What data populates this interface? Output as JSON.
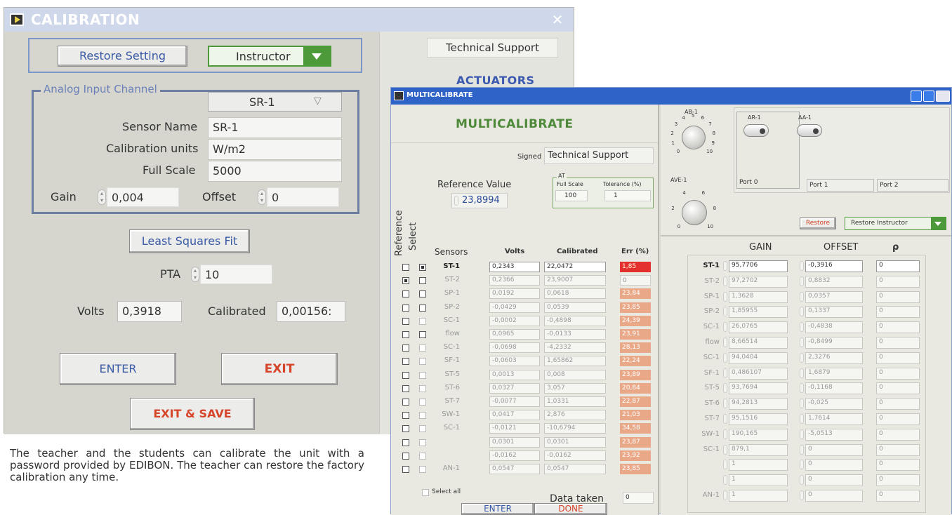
{
  "calibration": {
    "title": "CALIBRATION",
    "close_label": "✕",
    "restore_setting": "Restore Setting",
    "role": "Instructor",
    "group_label": "Analog Input Channel",
    "channel": "SR-1",
    "sensor_name_label": "Sensor Name",
    "sensor_name": "SR-1",
    "units_label": "Calibration units",
    "units": "W/m2",
    "full_scale_label": "Full Scale",
    "full_scale": "5000",
    "gain_label": "Gain",
    "gain": "0,004",
    "offset_label": "Offset",
    "offset": "0",
    "lsq_fit": "Least Squares Fit",
    "pta_label": "PTA",
    "pta": "10",
    "volts_label": "Volts",
    "volts": "0,3918",
    "calibrated_label": "Calibrated",
    "calibrated": "0,00156:",
    "enter": "ENTER",
    "exit": "EXIT",
    "exit_save": "EXIT & SAVE",
    "tech_support": "Technical Support",
    "actuators": "ACTUATORS"
  },
  "caption": "The teacher and the students can calibrate the unit with a password provided by EDIBON. The teacher can restore the factory calibration any time.",
  "multicalibrate": {
    "title": "MULTICALIBRATE",
    "heading": "MULTICALIBRATE",
    "signed_label": "Signed",
    "signed": "Technical Support",
    "ref_value_label": "Reference Value",
    "ref_value": "23,8994",
    "at_label": "AT",
    "full_scale_label": "Full Scale",
    "full_scale": "100",
    "tolerance_label": "Tolerance (%)",
    "tolerance": "1",
    "reference_label": "Reference",
    "select_label": "Select",
    "col_sensors": "Sensors",
    "col_volts": "Volts",
    "col_calibrated": "Calibrated",
    "col_err": "Err (%)",
    "select_all": "Select all",
    "data_taken_label": "Data taken",
    "data_taken": "0",
    "enter": "ENTER",
    "done": "DONE",
    "rows": [
      {
        "sensor": "ST-1",
        "volts": "0,2343",
        "calibrated": "22,0472",
        "err": "1,85"
      },
      {
        "sensor": "ST-2",
        "volts": "0,2366",
        "calibrated": "23,9007",
        "err": "0"
      },
      {
        "sensor": "SP-1",
        "volts": "0,0192",
        "calibrated": "0,0618",
        "err": "23,84"
      },
      {
        "sensor": "SP-2",
        "volts": "-0,0429",
        "calibrated": "0,0539",
        "err": "23,85"
      },
      {
        "sensor": "SC-1",
        "volts": "-0,0002",
        "calibrated": "-0,4898",
        "err": "24,39"
      },
      {
        "sensor": "flow",
        "volts": "0,0965",
        "calibrated": "-0,0133",
        "err": "23,91"
      },
      {
        "sensor": "SC-1",
        "volts": "-0,0698",
        "calibrated": "-4,2332",
        "err": "28,13"
      },
      {
        "sensor": "SF-1",
        "volts": "-0,0603",
        "calibrated": "1,65862",
        "err": "22,24"
      },
      {
        "sensor": "ST-5",
        "volts": "0,0013",
        "calibrated": "0,008",
        "err": "23,89"
      },
      {
        "sensor": "ST-6",
        "volts": "0,0327",
        "calibrated": "3,057",
        "err": "20,84"
      },
      {
        "sensor": "ST-7",
        "volts": "-0,0077",
        "calibrated": "1,0331",
        "err": "22,87"
      },
      {
        "sensor": "SW-1",
        "volts": "0,0417",
        "calibrated": "2,876",
        "err": "21,03"
      },
      {
        "sensor": "SC-1",
        "volts": "-0,0121",
        "calibrated": "-10,6794",
        "err": "34,58"
      },
      {
        "sensor": "",
        "volts": "0,0301",
        "calibrated": "0,0301",
        "err": "23,87"
      },
      {
        "sensor": "",
        "volts": "-0,0162",
        "calibrated": "-0,0162",
        "err": "23,92"
      },
      {
        "sensor": "AN-1",
        "volts": "0,0547",
        "calibrated": "0,0547",
        "err": "23,85"
      }
    ],
    "knob_ab_label": "AB-1",
    "knob_ab_ticks": [
      "0",
      "1",
      "2",
      "3",
      "4",
      "5",
      "6",
      "7",
      "8",
      "9",
      "10"
    ],
    "knob_ave_label": "AVE-1",
    "knob_ave_ticks": [
      "0",
      "2",
      "4",
      "6",
      "8",
      "10"
    ],
    "ar_label": "AR-1",
    "aa_label": "AA-1",
    "ports": [
      "Port 0",
      "Port 1",
      "Port 2"
    ],
    "restore": "Restore",
    "restore_instructor": "Restore Instructor",
    "col_gain": "GAIN",
    "col_offset": "OFFSET",
    "col_rho": "ρ",
    "rows_right": [
      {
        "sensor": "ST-1",
        "gain": "95,7706",
        "offset": "-0,3916",
        "rho": "0"
      },
      {
        "sensor": "ST-2",
        "gain": "97,2702",
        "offset": "0,8832",
        "rho": "0"
      },
      {
        "sensor": "SP-1",
        "gain": "1,3628",
        "offset": "0,0357",
        "rho": "0"
      },
      {
        "sensor": "SP-2",
        "gain": "1,85955",
        "offset": "0,1337",
        "rho": "0"
      },
      {
        "sensor": "SC-1",
        "gain": "26,0765",
        "offset": "-0,4838",
        "rho": "0"
      },
      {
        "sensor": "flow",
        "gain": "8,66514",
        "offset": "-0,8499",
        "rho": "0"
      },
      {
        "sensor": "SC-1",
        "gain": "94,0404",
        "offset": "2,3276",
        "rho": "0"
      },
      {
        "sensor": "SF-1",
        "gain": "0,486107",
        "offset": "1,6879",
        "rho": "0"
      },
      {
        "sensor": "ST-5",
        "gain": "93,7694",
        "offset": "-0,1168",
        "rho": "0"
      },
      {
        "sensor": "ST-6",
        "gain": "94,2813",
        "offset": "-0,025",
        "rho": "0"
      },
      {
        "sensor": "ST-7",
        "gain": "95,1516",
        "offset": "1,7614",
        "rho": "0"
      },
      {
        "sensor": "SW-1",
        "gain": "190,165",
        "offset": "-5,0513",
        "rho": "0"
      },
      {
        "sensor": "SC-1",
        "gain": "879,1",
        "offset": "0",
        "rho": "0"
      },
      {
        "sensor": "",
        "gain": "1",
        "offset": "0",
        "rho": "0"
      },
      {
        "sensor": "",
        "gain": "1",
        "offset": "0",
        "rho": "0"
      },
      {
        "sensor": "AN-1",
        "gain": "1",
        "offset": "0",
        "rho": "0"
      }
    ]
  }
}
